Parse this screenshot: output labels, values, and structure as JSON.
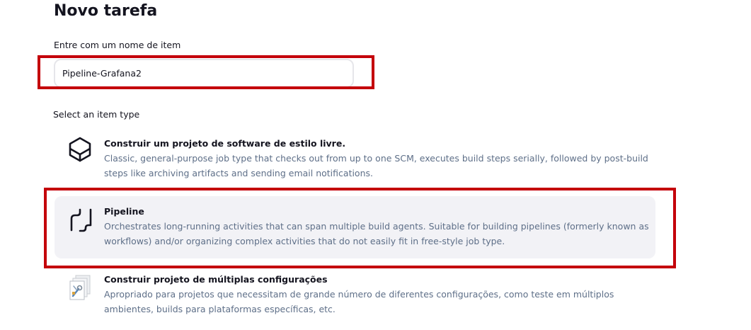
{
  "page": {
    "title": "Novo tarefa"
  },
  "name_field": {
    "label": "Entre com um nome de item",
    "value": "Pipeline-Grafana2"
  },
  "item_types": {
    "label": "Select an item type",
    "items": [
      {
        "icon": "cube-icon",
        "title": "Construir um projeto de software de estilo livre.",
        "description": "Classic, general-purpose job type that checks out from up to one SCM, executes build steps serially, followed by post-build steps like archiving artifacts and sending email notifications.",
        "selected": false
      },
      {
        "icon": "pipeline-icon",
        "title": "Pipeline",
        "description": "Orchestrates long-running activities that can span multiple build agents. Suitable for building pipelines (formerly known as workflows) and/or organizing complex activities that do not easily fit in free-style job type.",
        "selected": true
      },
      {
        "icon": "multi-config-icon",
        "title": "Construir projeto de múltiplas configurações",
        "description": "Apropriado para projetos que necessitam de grande número de diferentes configurações, como teste em múltiplos ambientes, builds para plataformas específicas, etc.",
        "selected": false
      }
    ]
  },
  "colors": {
    "highlight": "#c4000a",
    "selected_background": "#f2f2f6",
    "description_text": "#5e6f88"
  }
}
